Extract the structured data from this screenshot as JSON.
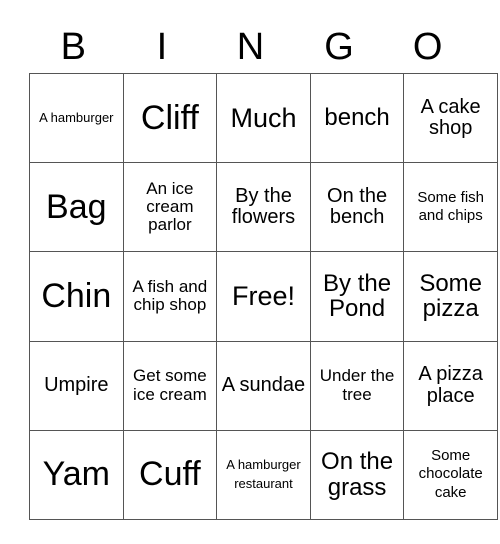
{
  "header": {
    "letters": [
      "B",
      "I",
      "N",
      "G",
      "O"
    ]
  },
  "card": {
    "rows": [
      [
        "A hamburger",
        "Cliff",
        "Much",
        "bench",
        "A cake shop"
      ],
      [
        "Bag",
        "An ice cream parlor",
        "By the flowers",
        "On the bench",
        "Some fish and chips"
      ],
      [
        "Chin",
        "A fish and chip shop",
        "Free!",
        "By the Pond",
        "Some pizza"
      ],
      [
        "Umpire",
        "Get some ice cream",
        "A sundae",
        "Under the tree",
        "A pizza place"
      ],
      [
        "Yam",
        "Cuff",
        "A hamburger restaurant",
        "On the grass",
        "Some chocolate cake"
      ]
    ],
    "free_space": "Free!"
  }
}
